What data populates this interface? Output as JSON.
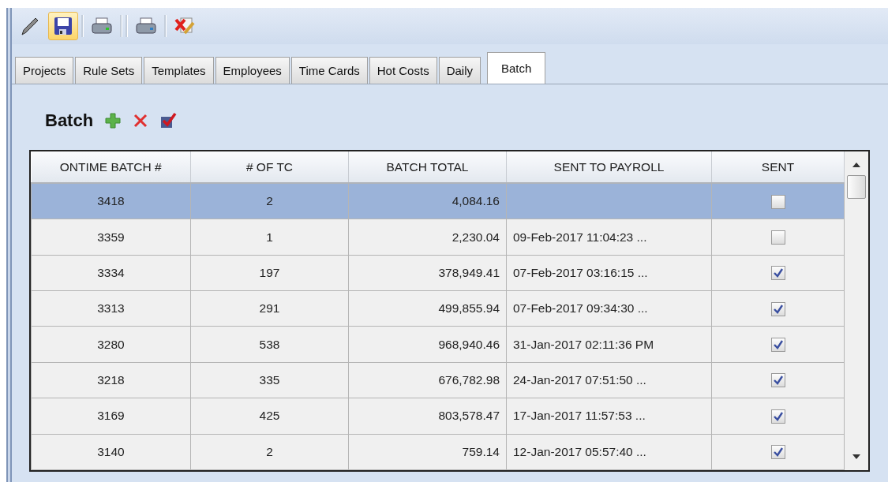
{
  "toolbar": [
    {
      "kind": "pencil",
      "highlighted": false
    },
    {
      "kind": "save",
      "highlighted": true
    },
    {
      "kind": "separator"
    },
    {
      "kind": "printer-green",
      "highlighted": false
    },
    {
      "kind": "separator"
    },
    {
      "kind": "separator"
    },
    {
      "kind": "printer-blue",
      "highlighted": false
    },
    {
      "kind": "separator"
    },
    {
      "kind": "delete-doc",
      "highlighted": false
    }
  ],
  "tabs": [
    {
      "label": "Projects",
      "selected": false
    },
    {
      "label": "Rule Sets",
      "selected": false
    },
    {
      "label": "Templates",
      "selected": false
    },
    {
      "label": "Employees",
      "selected": false
    },
    {
      "label": "Time Cards",
      "selected": false
    },
    {
      "label": "Hot Costs",
      "selected": false
    },
    {
      "label": "Daily",
      "selected": false
    },
    {
      "label": "Batch",
      "selected": true
    }
  ],
  "panel": {
    "title": "Batch",
    "actions": [
      {
        "kind": "add"
      },
      {
        "kind": "delete"
      },
      {
        "kind": "mark"
      }
    ]
  },
  "table": {
    "columns": [
      "ONTIME BATCH #",
      "# OF TC",
      "BATCH TOTAL",
      "SENT TO PAYROLL",
      "SENT"
    ],
    "rows": [
      {
        "batch": "3418",
        "tc": "2",
        "total": "4,084.16",
        "sent_to_payroll": "",
        "sent": false,
        "selected": true
      },
      {
        "batch": "3359",
        "tc": "1",
        "total": "2,230.04",
        "sent_to_payroll": "09-Feb-2017 11:04:23 ...",
        "sent": false,
        "selected": false
      },
      {
        "batch": "3334",
        "tc": "197",
        "total": "378,949.41",
        "sent_to_payroll": "07-Feb-2017 03:16:15 ...",
        "sent": true,
        "selected": false
      },
      {
        "batch": "3313",
        "tc": "291",
        "total": "499,855.94",
        "sent_to_payroll": "07-Feb-2017 09:34:30 ...",
        "sent": true,
        "selected": false
      },
      {
        "batch": "3280",
        "tc": "538",
        "total": "968,940.46",
        "sent_to_payroll": "31-Jan-2017 02:11:36 PM",
        "sent": true,
        "selected": false
      },
      {
        "batch": "3218",
        "tc": "335",
        "total": "676,782.98",
        "sent_to_payroll": "24-Jan-2017 07:51:50 ...",
        "sent": true,
        "selected": false
      },
      {
        "batch": "3169",
        "tc": "425",
        "total": "803,578.47",
        "sent_to_payroll": "17-Jan-2017 11:57:53 ...",
        "sent": true,
        "selected": false
      },
      {
        "batch": "3140",
        "tc": "2",
        "total": "759.14",
        "sent_to_payroll": "12-Jan-2017 05:57:40 ...",
        "sent": true,
        "selected": false
      }
    ]
  }
}
